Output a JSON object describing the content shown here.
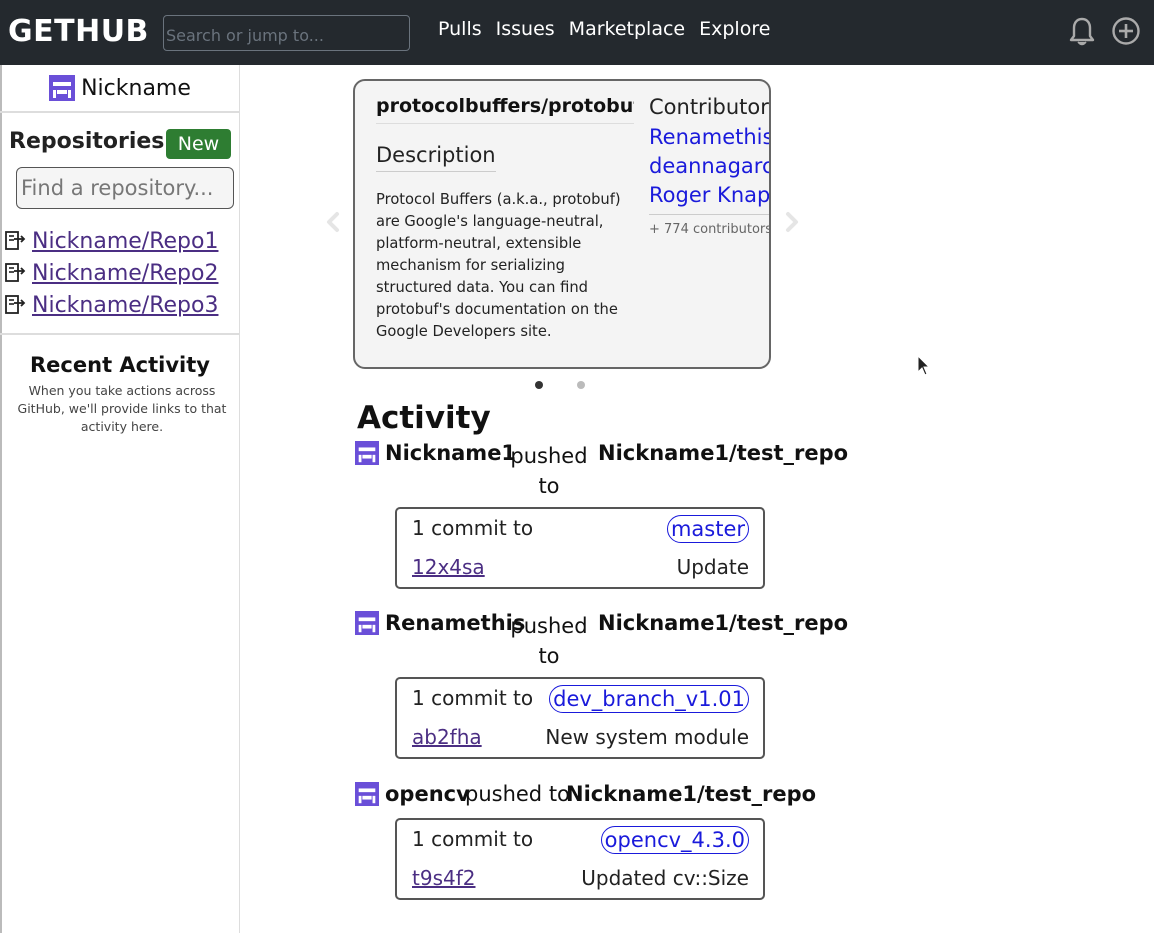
{
  "header": {
    "logo": "GETHUB",
    "search_placeholder": "Search or jump to...",
    "nav": [
      "Pulls",
      "Issues",
      "Marketplace",
      "Explore"
    ],
    "icons": [
      "bell-icon",
      "plus-circle-icon"
    ]
  },
  "sidebar": {
    "username": "Nickname",
    "repositories_heading": "Repositories",
    "new_button": "New",
    "find_placeholder": "Find a repository...",
    "repos": [
      "Nickname/Repo1",
      "Nickname/Repo2",
      "Nickname/Repo3"
    ],
    "recent_title": "Recent Activity",
    "recent_text": "When you take actions across GitHub, we'll provide links to that activity here."
  },
  "carousel": {
    "repo": "protocolbuffers/protobuf",
    "description_heading": "Description",
    "description": "Protocol Buffers (a.k.a., protobuf) are Google's language-neutral, platform-neutral, extensible mechanism for serializing structured data. You can find protobuf's documentation on the Google Developers site.",
    "contributors_heading": "Contributors",
    "contributors": [
      "Renamethis",
      "deannagarcia",
      "Roger Knapp"
    ],
    "more_contributors": "+ 774 contributors",
    "dots": 2,
    "active_dot": 0
  },
  "activity": {
    "title": "Activity",
    "events": [
      {
        "user": "Nickname1",
        "action": "pushed to",
        "repo": "Nickname1/test_repo",
        "commit_label": "1 commit to",
        "branch": "master",
        "hash": "12x4sa",
        "message": "Update"
      },
      {
        "user": "Renamethis",
        "action": "pushed to",
        "repo": "Nickname1/test_repo",
        "commit_label": "1 commit to",
        "branch": "dev_branch_v1.01",
        "hash": "ab2fha",
        "message": "New system module"
      },
      {
        "user": "opencv",
        "action": "pushed to",
        "repo": "Nickname1/test_repo",
        "commit_label": "1 commit to",
        "branch": "opencv_4.3.0",
        "hash": "t9s4f2",
        "message": "Updated cv::Size"
      }
    ]
  },
  "colors": {
    "header_bg": "#24292e",
    "new_button": "#2e7d32",
    "avatar": "#6a4fd8",
    "link": "#1a1adb",
    "visited_link": "#4b2e83"
  }
}
